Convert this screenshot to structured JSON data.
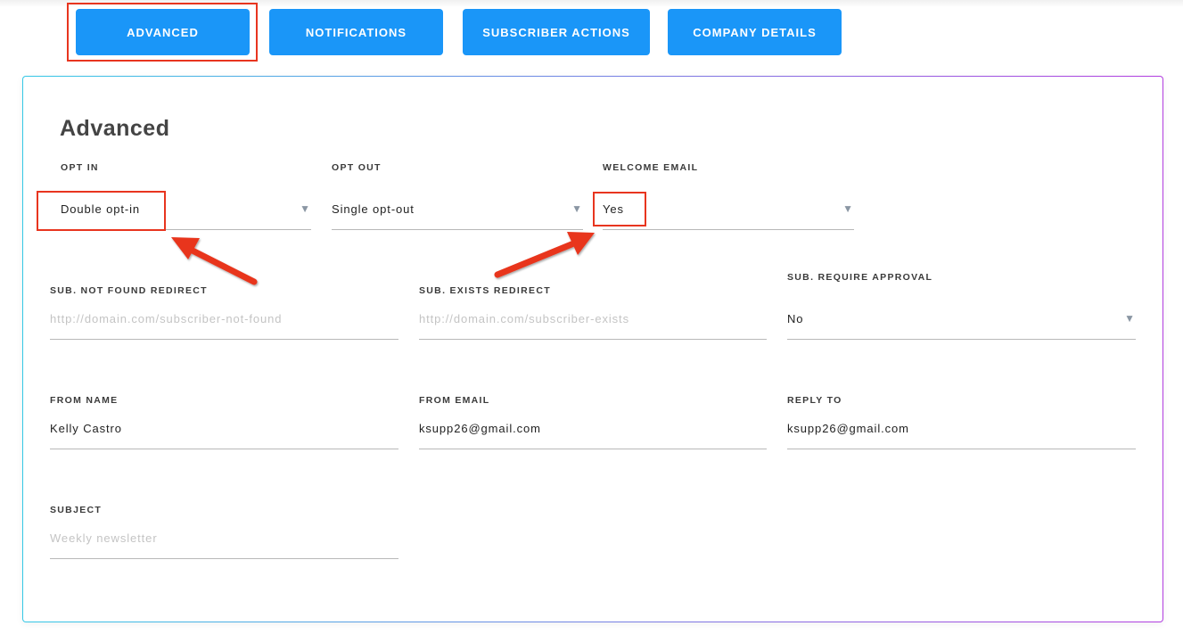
{
  "tabs": [
    {
      "label": "ADVANCED"
    },
    {
      "label": "NOTIFICATIONS"
    },
    {
      "label": "SUBSCRIBER ACTIONS"
    },
    {
      "label": "COMPANY DETAILS"
    }
  ],
  "section": {
    "title": "Advanced"
  },
  "fields": {
    "opt_in": {
      "label": "OPT IN",
      "value": "Double opt-in"
    },
    "opt_out": {
      "label": "OPT OUT",
      "value": "Single opt-out"
    },
    "welcome_email": {
      "label": "WELCOME EMAIL",
      "value": "Yes"
    },
    "sub_not_found_redirect": {
      "label": "SUB. NOT FOUND REDIRECT",
      "placeholder": "http://domain.com/subscriber-not-found"
    },
    "sub_exists_redirect": {
      "label": "SUB. EXISTS REDIRECT",
      "placeholder": "http://domain.com/subscriber-exists"
    },
    "sub_require_approval": {
      "label": "SUB. REQUIRE APPROVAL",
      "value": "No"
    },
    "from_name": {
      "label": "FROM NAME",
      "value": "Kelly Castro"
    },
    "from_email": {
      "label": "FROM EMAIL",
      "value": "ksupp26@gmail.com"
    },
    "reply_to": {
      "label": "REPLY TO",
      "value": "ksupp26@gmail.com"
    },
    "subject": {
      "label": "SUBJECT",
      "placeholder": "Weekly newsletter"
    }
  },
  "icons": {
    "dropdown": "▼",
    "dropdown_icon_name": "chevron-down-icon"
  },
  "colors": {
    "tab_bg": "#1a96f8",
    "highlight": "#e8351f",
    "card_border_start": "#35c8e6",
    "card_border_end": "#b23ee0"
  }
}
